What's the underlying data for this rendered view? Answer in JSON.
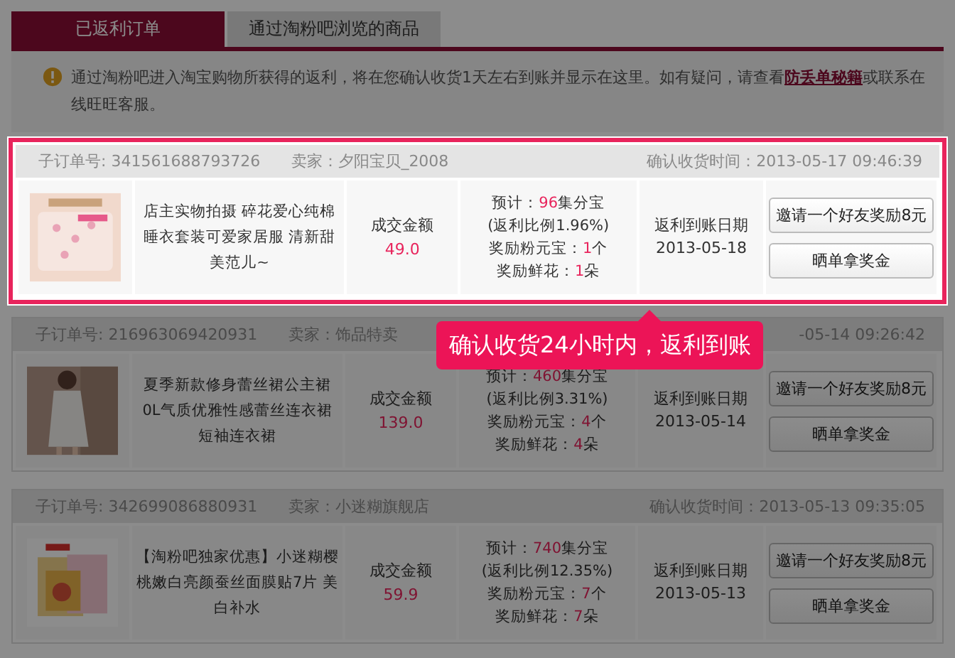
{
  "tabs": [
    {
      "label": "已返利订单",
      "selected": true
    },
    {
      "label": "通过淘粉吧浏览的商品",
      "selected": false
    }
  ],
  "notice": {
    "before": "通过淘粉吧进入淘宝购物所获得的返利，将在您确认收货1天左右到账并显示在这里。如有疑问，请查看",
    "link": "防丢单秘籍",
    "after": "或联系在线旺旺客服。"
  },
  "orders": [
    {
      "highlighted": true,
      "order_no": "子订单号: 341561688793726",
      "seller": "卖家：夕阳宝贝_2008",
      "confirm_time": "确认收货时间：2013-05-17 09:46:39",
      "title": "店主实物拍摄  碎花爱心纯棉睡衣套装可爱家居服  清新甜美范儿~",
      "amount_label": "成交金额",
      "amount": "49.0",
      "estimate": [
        [
          {
            "text": "预计："
          },
          {
            "text": "96",
            "highlight": true
          },
          {
            "text": "集分宝"
          }
        ],
        [
          {
            "text": "(返利比例1.96%)"
          }
        ],
        [
          {
            "text": "奖励粉元宝："
          },
          {
            "text": "1",
            "highlight": true
          },
          {
            "text": "个"
          }
        ],
        [
          {
            "text": "奖励鲜花："
          },
          {
            "text": "1",
            "highlight": true
          },
          {
            "text": "朵"
          }
        ]
      ],
      "date_label": "返利到账日期",
      "date": "2013-05-18",
      "buttons": [
        "邀请一个好友奖励8元",
        "晒单拿奖金"
      ]
    },
    {
      "highlighted": false,
      "order_no": "子订单号: 216963069420931",
      "seller": "卖家：饰品特卖",
      "confirm_time": "-05-14 09:26:42",
      "title": "夏季新款修身蕾丝裙公主裙  0L气质优雅性感蕾丝连衣裙短袖连衣裙",
      "amount_label": "成交金额",
      "amount": "139.0",
      "estimate": [
        [
          {
            "text": "预计："
          },
          {
            "text": "460",
            "highlight": true
          },
          {
            "text": "集分宝"
          }
        ],
        [
          {
            "text": "(返利比例3.31%)"
          }
        ],
        [
          {
            "text": "奖励粉元宝："
          },
          {
            "text": "4",
            "highlight": true
          },
          {
            "text": "个"
          }
        ],
        [
          {
            "text": "奖励鲜花："
          },
          {
            "text": "4",
            "highlight": true
          },
          {
            "text": "朵"
          }
        ]
      ],
      "date_label": "返利到账日期",
      "date": "2013-05-14",
      "buttons": [
        "邀请一个好友奖励8元",
        "晒单拿奖金"
      ]
    },
    {
      "highlighted": false,
      "order_no": "子订单号: 342699086880931",
      "seller": "卖家：小迷糊旗舰店",
      "confirm_time": "确认收货时间：2013-05-13 09:35:05",
      "title": "【淘粉吧独家优惠】小迷糊樱桃嫩白亮颜蚕丝面膜贴7片  美白补水",
      "amount_label": "成交金额",
      "amount": "59.9",
      "estimate": [
        [
          {
            "text": "预计："
          },
          {
            "text": "740",
            "highlight": true
          },
          {
            "text": "集分宝"
          }
        ],
        [
          {
            "text": "(返利比例12.35%)"
          }
        ],
        [
          {
            "text": "奖励粉元宝："
          },
          {
            "text": "7",
            "highlight": true
          },
          {
            "text": "个"
          }
        ],
        [
          {
            "text": "奖励鲜花："
          },
          {
            "text": "7",
            "highlight": true
          },
          {
            "text": "朵"
          }
        ]
      ],
      "date_label": "返利到账日期",
      "date": "2013-05-13",
      "buttons": [
        "邀请一个好友奖励8元",
        "晒单拿奖金"
      ]
    }
  ],
  "tooltip": "确认收货24小时内，返利到账"
}
